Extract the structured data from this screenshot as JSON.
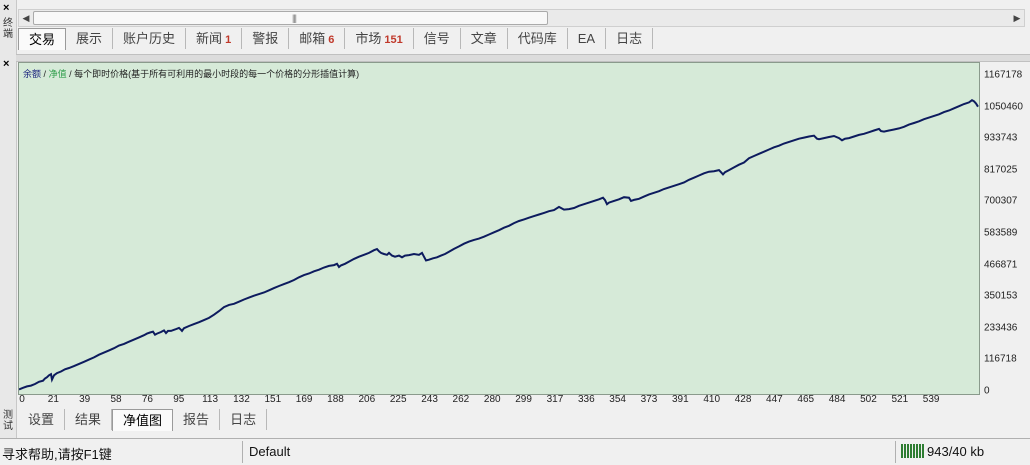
{
  "left_strip": {
    "close_top": "×",
    "label_top": "终端",
    "close_mid": "×",
    "label_bottom": "测试"
  },
  "terminal_tabs": [
    {
      "label": "交易",
      "count": ""
    },
    {
      "label": "展示",
      "count": ""
    },
    {
      "label": "账户历史",
      "count": ""
    },
    {
      "label": "新闻",
      "count": "1"
    },
    {
      "label": "警报",
      "count": ""
    },
    {
      "label": "邮箱",
      "count": "6"
    },
    {
      "label": "市场",
      "count": "151"
    },
    {
      "label": "信号",
      "count": ""
    },
    {
      "label": "文章",
      "count": ""
    },
    {
      "label": "代码库",
      "count": ""
    },
    {
      "label": "EA",
      "count": ""
    },
    {
      "label": "日志",
      "count": ""
    }
  ],
  "active_terminal_tab": "交易",
  "chart_legend": {
    "balance": "余额",
    "sep1": "/",
    "equity": "净值",
    "sep2": "/",
    "note": "每个即时价格(基于所有可利用的最小时段的每一个价格的分形插值计算)"
  },
  "chart_data": {
    "type": "line",
    "series": [
      {
        "name": "余额",
        "color": "#0d1b5e",
        "points": [
          [
            0,
            6000
          ],
          [
            4,
            12000
          ],
          [
            8,
            17000
          ],
          [
            12,
            20000
          ],
          [
            16,
            26000
          ],
          [
            20,
            34000
          ],
          [
            24,
            38000
          ],
          [
            26,
            46000
          ],
          [
            28,
            51000
          ],
          [
            30,
            58000
          ],
          [
            32,
            62000
          ],
          [
            33,
            42000
          ],
          [
            35,
            58000
          ],
          [
            38,
            66000
          ],
          [
            42,
            72000
          ],
          [
            46,
            80000
          ],
          [
            50,
            85000
          ],
          [
            55,
            92000
          ],
          [
            60,
            100000
          ],
          [
            65,
            108000
          ],
          [
            70,
            116000
          ],
          [
            75,
            124000
          ],
          [
            80,
            134000
          ],
          [
            85,
            142000
          ],
          [
            90,
            150000
          ],
          [
            95,
            158000
          ],
          [
            100,
            168000
          ],
          [
            105,
            174000
          ],
          [
            110,
            182000
          ],
          [
            115,
            190000
          ],
          [
            120,
            198000
          ],
          [
            125,
            206000
          ],
          [
            128,
            212000
          ],
          [
            131,
            216000
          ],
          [
            134,
            219000
          ],
          [
            136,
            208000
          ],
          [
            138,
            212000
          ],
          [
            142,
            218000
          ],
          [
            145,
            224000
          ],
          [
            147,
            214000
          ],
          [
            149,
            222000
          ],
          [
            152,
            222000
          ],
          [
            156,
            227000
          ],
          [
            160,
            233000
          ],
          [
            162,
            226000
          ],
          [
            163,
            222000
          ],
          [
            165,
            232000
          ],
          [
            170,
            240000
          ],
          [
            175,
            247000
          ],
          [
            180,
            254000
          ],
          [
            185,
            262000
          ],
          [
            190,
            270000
          ],
          [
            195,
            282000
          ],
          [
            200,
            295000
          ],
          [
            205,
            310000
          ],
          [
            210,
            318000
          ],
          [
            215,
            322000
          ],
          [
            220,
            330000
          ],
          [
            225,
            338000
          ],
          [
            230,
            345000
          ],
          [
            235,
            352000
          ],
          [
            240,
            358000
          ],
          [
            245,
            364000
          ],
          [
            250,
            372000
          ],
          [
            255,
            380000
          ],
          [
            260,
            388000
          ],
          [
            265,
            395000
          ],
          [
            270,
            402000
          ],
          [
            275,
            410000
          ],
          [
            280,
            420000
          ],
          [
            285,
            428000
          ],
          [
            290,
            434000
          ],
          [
            295,
            442000
          ],
          [
            300,
            448000
          ],
          [
            305,
            456000
          ],
          [
            310,
            462000
          ],
          [
            315,
            465000
          ],
          [
            318,
            470000
          ],
          [
            320,
            458000
          ],
          [
            322,
            464000
          ],
          [
            326,
            470000
          ],
          [
            330,
            478000
          ],
          [
            335,
            488000
          ],
          [
            340,
            496000
          ],
          [
            345,
            503000
          ],
          [
            350,
            510000
          ],
          [
            355,
            520000
          ],
          [
            358,
            524000
          ],
          [
            360,
            516000
          ],
          [
            362,
            510000
          ],
          [
            365,
            506000
          ],
          [
            368,
            503000
          ],
          [
            370,
            510000
          ],
          [
            373,
            500000
          ],
          [
            376,
            496000
          ],
          [
            380,
            500000
          ],
          [
            383,
            494000
          ],
          [
            386,
            500000
          ],
          [
            390,
            502000
          ],
          [
            395,
            506000
          ],
          [
            400,
            503000
          ],
          [
            403,
            510000
          ],
          [
            405,
            496000
          ],
          [
            407,
            482000
          ],
          [
            410,
            485000
          ],
          [
            414,
            490000
          ],
          [
            418,
            494000
          ],
          [
            422,
            500000
          ],
          [
            426,
            506000
          ],
          [
            430,
            514000
          ],
          [
            435,
            525000
          ],
          [
            440,
            534000
          ],
          [
            445,
            544000
          ],
          [
            450,
            552000
          ],
          [
            455,
            558000
          ],
          [
            460,
            563000
          ],
          [
            465,
            570000
          ],
          [
            470,
            578000
          ],
          [
            475,
            586000
          ],
          [
            480,
            594000
          ],
          [
            485,
            603000
          ],
          [
            490,
            610000
          ],
          [
            495,
            620000
          ],
          [
            500,
            628000
          ],
          [
            505,
            634000
          ],
          [
            510,
            640000
          ],
          [
            515,
            646000
          ],
          [
            520,
            652000
          ],
          [
            525,
            658000
          ],
          [
            530,
            664000
          ],
          [
            535,
            668000
          ],
          [
            540,
            680000
          ],
          [
            542,
            676000
          ],
          [
            545,
            670000
          ],
          [
            550,
            672000
          ],
          [
            555,
            676000
          ],
          [
            560,
            684000
          ],
          [
            565,
            690000
          ],
          [
            570,
            696000
          ],
          [
            575,
            702000
          ],
          [
            580,
            708000
          ],
          [
            584,
            714000
          ],
          [
            586,
            705000
          ],
          [
            588,
            690000
          ],
          [
            590,
            696000
          ],
          [
            595,
            702000
          ],
          [
            600,
            708000
          ],
          [
            605,
            716000
          ],
          [
            610,
            714000
          ],
          [
            612,
            702000
          ],
          [
            615,
            706000
          ],
          [
            620,
            710000
          ],
          [
            625,
            718000
          ],
          [
            630,
            726000
          ],
          [
            635,
            732000
          ],
          [
            640,
            738000
          ],
          [
            645,
            746000
          ],
          [
            650,
            752000
          ],
          [
            655,
            758000
          ],
          [
            660,
            764000
          ],
          [
            665,
            770000
          ],
          [
            670,
            780000
          ],
          [
            675,
            788000
          ],
          [
            680,
            796000
          ],
          [
            685,
            804000
          ],
          [
            690,
            810000
          ],
          [
            695,
            812000
          ],
          [
            700,
            816000
          ],
          [
            702,
            808000
          ],
          [
            704,
            800000
          ],
          [
            706,
            808000
          ],
          [
            710,
            816000
          ],
          [
            715,
            826000
          ],
          [
            720,
            836000
          ],
          [
            725,
            844000
          ],
          [
            730,
            860000
          ],
          [
            735,
            868000
          ],
          [
            740,
            876000
          ],
          [
            745,
            884000
          ],
          [
            750,
            892000
          ],
          [
            755,
            900000
          ],
          [
            760,
            906000
          ],
          [
            765,
            914000
          ],
          [
            770,
            920000
          ],
          [
            775,
            926000
          ],
          [
            780,
            932000
          ],
          [
            785,
            936000
          ],
          [
            790,
            940000
          ],
          [
            795,
            943000
          ],
          [
            798,
            932000
          ],
          [
            800,
            930000
          ],
          [
            805,
            934000
          ],
          [
            810,
            938000
          ],
          [
            815,
            942000
          ],
          [
            820,
            934000
          ],
          [
            823,
            926000
          ],
          [
            826,
            932000
          ],
          [
            830,
            934000
          ],
          [
            835,
            940000
          ],
          [
            840,
            946000
          ],
          [
            845,
            950000
          ],
          [
            850,
            956000
          ],
          [
            855,
            962000
          ],
          [
            860,
            968000
          ],
          [
            862,
            960000
          ],
          [
            865,
            958000
          ],
          [
            870,
            962000
          ],
          [
            875,
            966000
          ],
          [
            880,
            970000
          ],
          [
            885,
            976000
          ],
          [
            890,
            984000
          ],
          [
            895,
            990000
          ],
          [
            900,
            996000
          ],
          [
            905,
            1004000
          ],
          [
            910,
            1010000
          ],
          [
            915,
            1016000
          ],
          [
            920,
            1022000
          ],
          [
            925,
            1030000
          ],
          [
            930,
            1036000
          ],
          [
            935,
            1044000
          ],
          [
            940,
            1052000
          ],
          [
            945,
            1060000
          ],
          [
            950,
            1066000
          ],
          [
            953,
            1074000
          ],
          [
            955,
            1070000
          ],
          [
            957,
            1062000
          ],
          [
            959,
            1050000
          ]
        ]
      }
    ],
    "y_ticks": [
      "1167178",
      "1050460",
      "933743",
      "817025",
      "700307",
      "583589",
      "466871",
      "350153",
      "233436",
      "116718",
      "0"
    ],
    "y_range": [
      0,
      1167178
    ],
    "x_ticks": [
      "0",
      "21",
      "39",
      "58",
      "76",
      "95",
      "113",
      "132",
      "151",
      "169",
      "188",
      "206",
      "225",
      "243",
      "262",
      "280",
      "299",
      "317",
      "336",
      "354",
      "373",
      "391",
      "410",
      "428",
      "447",
      "465",
      "484",
      "502",
      "521",
      "539"
    ],
    "grid": false
  },
  "bottom_tabs": [
    {
      "label": "设置"
    },
    {
      "label": "结果"
    },
    {
      "label": "净值图"
    },
    {
      "label": "报告"
    },
    {
      "label": "日志"
    }
  ],
  "active_bottom_tab": "净值图",
  "status_bar": {
    "help": "寻求帮助,请按F1键",
    "profile": "Default",
    "traffic": "943/40 kb"
  },
  "colors": {
    "chart_bg": "#d6ead8",
    "balance_line": "#0d1b5e",
    "equity_legend": "#2e9d4a",
    "count_badge": "#c0392b"
  }
}
